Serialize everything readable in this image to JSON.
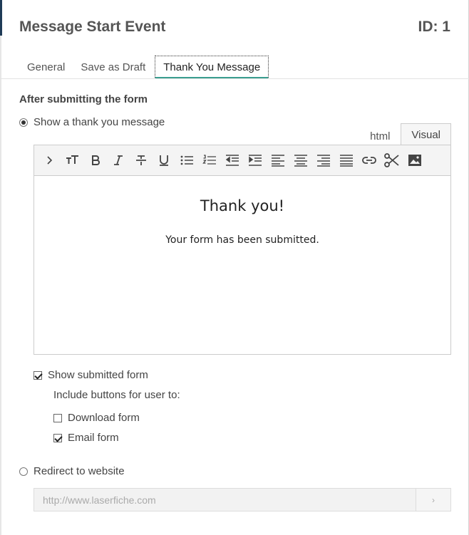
{
  "dialog": {
    "title": "Message Start Event",
    "id_label": "ID: 1"
  },
  "tabs": [
    {
      "label": "General",
      "active": false
    },
    {
      "label": "Save as Draft",
      "active": false
    },
    {
      "label": "Thank You Message",
      "active": true
    }
  ],
  "section_heading": "After submitting the form",
  "options": {
    "show_message": {
      "label": "Show a thank you message",
      "selected": true
    },
    "redirect": {
      "label": "Redirect to website",
      "selected": false
    }
  },
  "editor": {
    "tabs": [
      {
        "label": "html",
        "active": false
      },
      {
        "label": "Visual",
        "active": true
      }
    ],
    "toolbar_icons": [
      "chevron-right-icon",
      "font-size-icon",
      "bold-icon",
      "italic-icon",
      "strikethrough-icon",
      "underline-icon",
      "bullet-list-icon",
      "numbered-list-icon",
      "outdent-icon",
      "indent-icon",
      "align-left-icon",
      "align-center-icon",
      "align-right-icon",
      "justify-icon",
      "link-icon",
      "cut-icon",
      "image-icon"
    ],
    "content": {
      "heading": "Thank you!",
      "body": "Your form has been submitted."
    }
  },
  "submitted_form": {
    "show_label": "Show submitted form",
    "show_checked": true,
    "include_label": "Include buttons for user to:",
    "download_label": "Download form",
    "download_checked": false,
    "email_label": "Email form",
    "email_checked": true
  },
  "redirect_url": {
    "placeholder": "http://www.laserfiche.com",
    "button_glyph": "›"
  }
}
